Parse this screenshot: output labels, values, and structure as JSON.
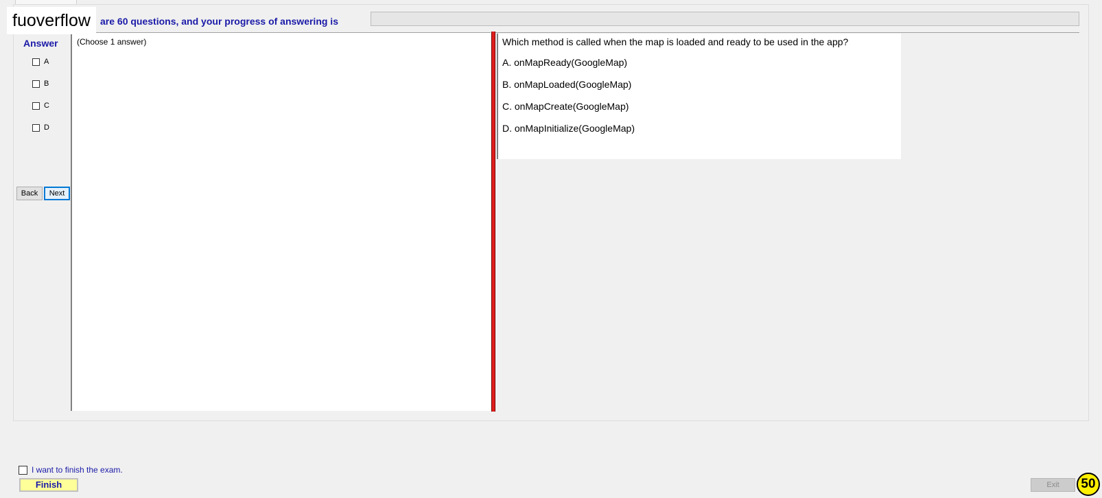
{
  "watermark": "fuoverflow",
  "header": {
    "progress_text": "are 60 questions, and your progress of answering is",
    "progress_fraction": 0
  },
  "answer_panel": {
    "title": "Answer",
    "options": [
      "A",
      "B",
      "C",
      "D"
    ],
    "back_label": "Back",
    "next_label": "Next"
  },
  "left_panel": {
    "instruction": "(Choose 1 answer)"
  },
  "question": {
    "text": "Which method is called when the map is loaded and ready to be used in the app?",
    "choices": [
      "A.  onMapReady(GoogleMap)",
      "B.  onMapLoaded(GoogleMap)",
      "C.  onMapCreate(GoogleMap)",
      "D.  onMapInitialize(GoogleMap)"
    ]
  },
  "footer": {
    "finish_checkbox_label": "I want to finish the exam.",
    "finish_label": "Finish",
    "exit_label": "Exit",
    "badge": "50"
  },
  "colors": {
    "accent_text": "#1a1aa8",
    "divider": "#e01e1e",
    "finish_bg": "#ffff99",
    "badge_bg": "#ffef00"
  }
}
